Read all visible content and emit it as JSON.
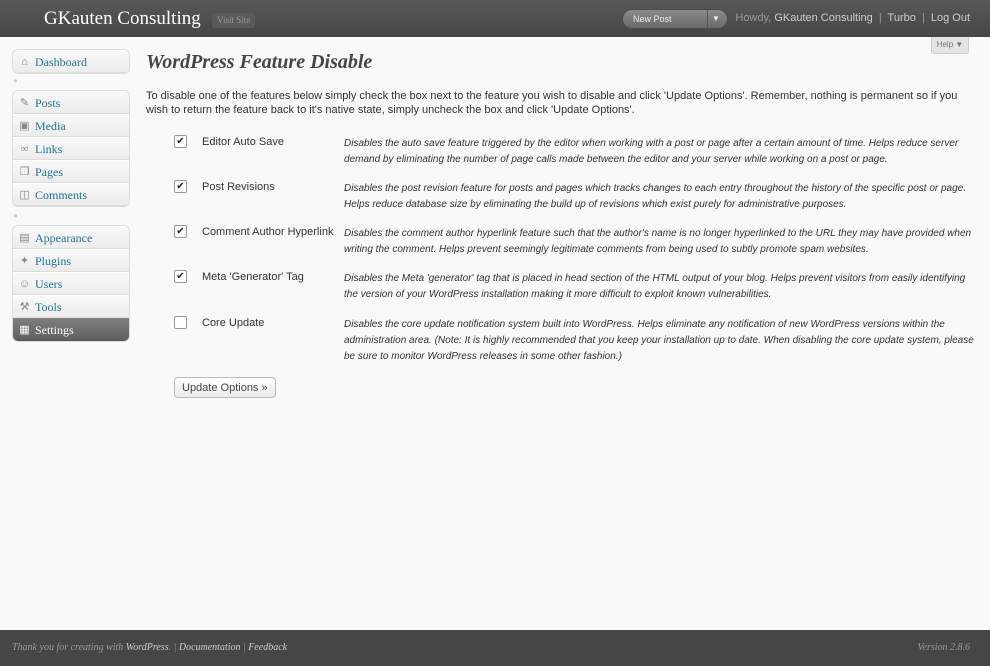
{
  "header": {
    "site_title": "GKauten Consulting",
    "visit_site": "Visit Site",
    "new_post": "New Post",
    "new_post_arrow": "▼",
    "howdy": "Howdy,",
    "user_name": "GKauten Consulting",
    "turbo": "Turbo",
    "logout": "Log Out",
    "pipe": "|"
  },
  "help": {
    "label": "Help ▼"
  },
  "sidebar": {
    "dashboard": {
      "label": "Dashboard",
      "icon": "⌂"
    },
    "items": [
      {
        "label": "Posts",
        "icon": "✎"
      },
      {
        "label": "Media",
        "icon": "▣"
      },
      {
        "label": "Links",
        "icon": "∞"
      },
      {
        "label": "Pages",
        "icon": "❐"
      },
      {
        "label": "Comments",
        "icon": "◫"
      }
    ],
    "items2": [
      {
        "label": "Appearance",
        "icon": "▤"
      },
      {
        "label": "Plugins",
        "icon": "✦"
      },
      {
        "label": "Users",
        "icon": "☺"
      },
      {
        "label": "Tools",
        "icon": "⚒"
      },
      {
        "label": "Settings",
        "icon": "▦"
      }
    ],
    "separator_mark": "●"
  },
  "main": {
    "title": "WordPress Feature Disable",
    "intro": "To disable one of the features below simply check the box next to the feature you wish to disable and click 'Update Options'. Remember, nothing is permanent so if you wish to return the feature back to it's native state, simply uncheck the box and click 'Update Options'.",
    "check_mark": "✔",
    "features": [
      {
        "name": "Editor Auto Save",
        "checked": true,
        "desc": "Disables the auto save feature triggered by the editor when working with a post or page after a certain amount of time. Helps reduce server demand by eliminating the number of page calls made between the editor and your server while working on a post or page."
      },
      {
        "name": "Post Revisions",
        "checked": true,
        "desc": "Disables the post revision feature for posts and pages which tracks changes to each entry throughout the history of the specific post or page. Helps reduce database size by eliminating the build up of revisions which exist purely for administrative purposes."
      },
      {
        "name": "Comment Author Hyperlink",
        "checked": true,
        "desc": "Disables the comment author hyperlink feature such that the author's name is no longer hyperlinked to the URL they may have provided when writing the comment. Helps prevent seemingly legitimate comments from being used to subtly promote spam websites."
      },
      {
        "name": "Meta 'Generator' Tag",
        "checked": true,
        "desc": "Disables the Meta 'generator' tag that is placed in head section of the HTML output of your blog. Helps prevent visitors from easily identifying the version of your WordPress installation making it more difficult to exploit known vulnerabilities."
      },
      {
        "name": "Core Update",
        "checked": false,
        "desc": "Disables the core update notification system built into WordPress. Helps eliminate any notification of new WordPress versions within the administration area. (Note: It is highly recommended that you keep your installation up to date. When disabling the core update system, please be sure to monitor WordPress releases in some other fashion.)"
      }
    ],
    "update_button": "Update Options »"
  },
  "footer": {
    "thanks": "Thank you for creating with",
    "wordpress": "WordPress",
    "period": ".",
    "documentation": "Documentation",
    "feedback": "Feedback",
    "pipe": "|",
    "version": "Version 2.8.6"
  }
}
